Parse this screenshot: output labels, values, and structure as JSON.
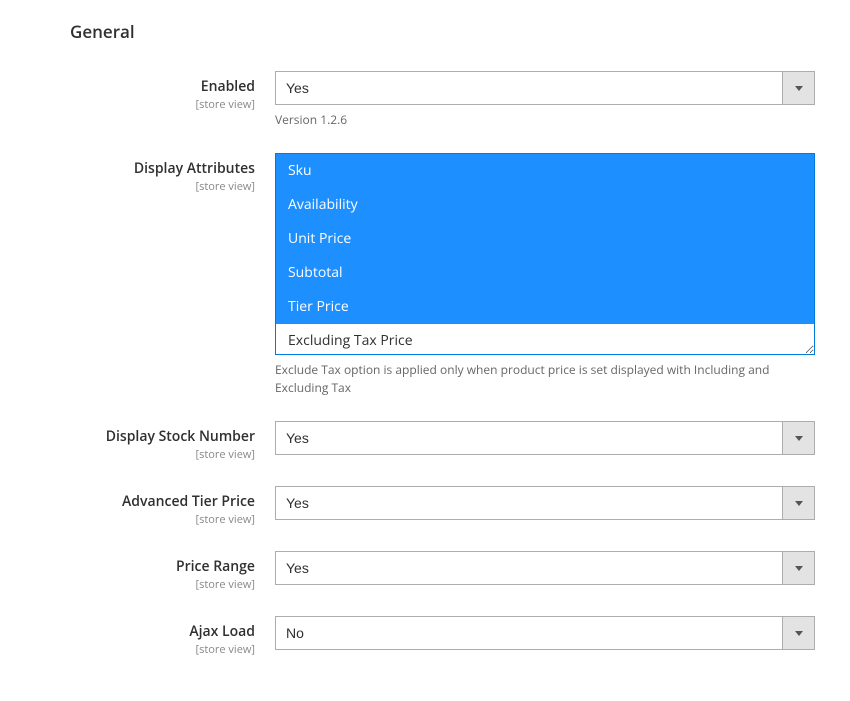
{
  "section_title": "General",
  "fields": {
    "enabled": {
      "label": "Enabled",
      "scope": "[store view]",
      "value": "Yes",
      "hint": "Version 1.2.6"
    },
    "display_attributes": {
      "label": "Display Attributes",
      "scope": "[store view]",
      "options": [
        {
          "label": "Sku",
          "selected": true
        },
        {
          "label": "Availability",
          "selected": true
        },
        {
          "label": "Unit Price",
          "selected": true
        },
        {
          "label": "Subtotal",
          "selected": true
        },
        {
          "label": "Tier Price",
          "selected": true
        },
        {
          "label": "Excluding Tax Price",
          "selected": false
        }
      ],
      "hint": "Exclude Tax option is applied only when product price is set displayed with Including and Excluding Tax"
    },
    "display_stock_number": {
      "label": "Display Stock Number",
      "scope": "[store view]",
      "value": "Yes"
    },
    "advanced_tier_price": {
      "label": "Advanced Tier Price",
      "scope": "[store view]",
      "value": "Yes"
    },
    "price_range": {
      "label": "Price Range",
      "scope": "[store view]",
      "value": "Yes"
    },
    "ajax_load": {
      "label": "Ajax Load",
      "scope": "[store view]",
      "value": "No"
    }
  }
}
